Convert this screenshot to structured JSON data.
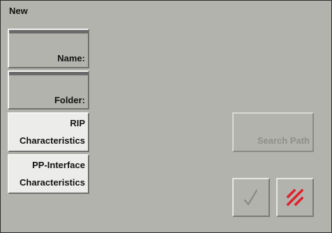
{
  "dialog": {
    "title": "New"
  },
  "fields": {
    "name_label": "Name:",
    "folder_label": "Folder:"
  },
  "buttons": {
    "rip_line1": "RIP",
    "rip_line2": "Characteristics",
    "pp_line1": "PP-Interface",
    "pp_line2": "Characteristics",
    "search_path": "Search Path"
  },
  "icons": {
    "ok": "checkmark-icon",
    "cancel": "cancel-hatch-icon"
  },
  "colors": {
    "background": "#b3b3ae",
    "cancel_red": "#e0202a"
  }
}
